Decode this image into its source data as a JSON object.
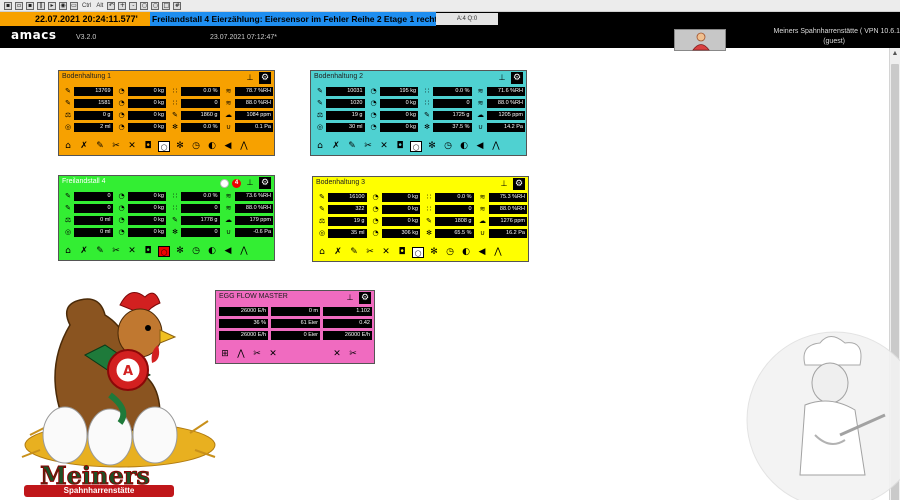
{
  "colors": {
    "orange": "#f7a100",
    "cyan": "#4fd1d1",
    "green": "#33ee33",
    "yellow": "#ffff00",
    "pink": "#f06bc0",
    "alarm_blue": "#1e8ef0"
  },
  "toolbar": {
    "ctrl_label": "Ctrl",
    "alt_label": "Alt"
  },
  "alarm": {
    "time": "22.07.2021 20:24:11.577'",
    "message": "Freilandstall 4 Eierzählung: Eiersensor im Fehler Reihe 2 Etage 1 rechts",
    "count": "A:4 Q:0"
  },
  "header": {
    "logo": "amacs",
    "version": "V3.2.0",
    "datetime": "23.07.2021 07:12:47*",
    "site_line1": "Meiners Spahnharrenstätte ( VPN 10.6.1",
    "site_line2": "(guest)"
  },
  "panels": [
    {
      "title": "Bodenhaltung 1",
      "values": [
        "13769",
        "0 kg",
        "0.0 %",
        "78.7 %RH",
        "1581",
        "0 kg",
        "0",
        "88.0 %RH",
        "0 g",
        "0 kg",
        "1860 g",
        "1084 ppm",
        "2 ml",
        "0 kg",
        "0.0 %",
        "0.1 Pa"
      ]
    },
    {
      "title": "Bodenhaltung 2",
      "values": [
        "10031",
        "195 kg",
        "0.0 %",
        "71.6 %RH",
        "1020",
        "0 kg",
        "0",
        "88.0 %RH",
        "19 g",
        "0 kg",
        "1725 g",
        "1205 ppm",
        "30 ml",
        "0 kg",
        "37.5 %",
        "14.2 Pa"
      ]
    },
    {
      "title": "Freilandstall 4",
      "badge": "4",
      "values": [
        "0",
        "0 kg",
        "0.0 %",
        "73.6 %RH",
        "0",
        "0 kg",
        "0",
        "88.0 %RH",
        "0 ml",
        "0 kg",
        "1778 g",
        "179 ppm",
        "0 ml",
        "0 kg",
        "0",
        "-0.6 Pa"
      ]
    },
    {
      "title": "Bodenhaltung 3",
      "values": [
        "16100",
        "0 kg",
        "0.0 %",
        "75.3 %RH",
        "322",
        "0 kg",
        "0",
        "88.0 %RH",
        "19 g",
        "0 kg",
        "1808 g",
        "1276 ppm",
        "35 ml",
        "306 kg",
        "65.5 %",
        "16.2 Pa"
      ]
    }
  ],
  "egg_flow_master": {
    "title": "EGG FLOW MASTER",
    "values": [
      "26000 E/h",
      "0 m",
      "1.102",
      "36 %",
      "61 Eier",
      "0.42",
      "26000 E/h",
      "0 Eier",
      "26000 E/h"
    ]
  },
  "logo": {
    "brand": "Meiners",
    "sub": "Spahnharrenstätte",
    "seal_letter": "A"
  }
}
